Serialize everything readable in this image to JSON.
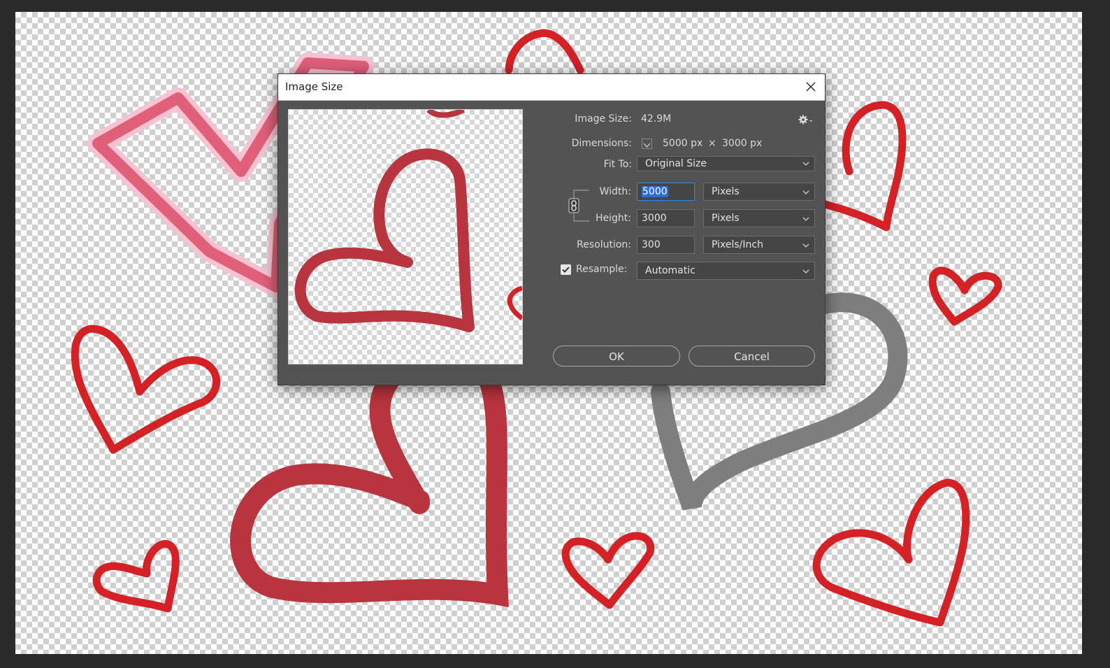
{
  "dialog": {
    "title": "Image Size",
    "image_size_label": "Image Size:",
    "image_size_value": "42.9M",
    "dimensions_label": "Dimensions:",
    "dimensions_width": "5000 px",
    "dimensions_separator": "×",
    "dimensions_height": "3000 px",
    "fit_to_label": "Fit To:",
    "fit_to_value": "Original Size",
    "width_label": "Width:",
    "width_value": "5000",
    "width_unit": "Pixels",
    "height_label": "Height:",
    "height_value": "3000",
    "height_unit": "Pixels",
    "resolution_label": "Resolution:",
    "resolution_value": "300",
    "resolution_unit": "Pixels/Inch",
    "resample_label": "Resample:",
    "resample_checked": true,
    "resample_value": "Automatic",
    "ok_label": "OK",
    "cancel_label": "Cancel"
  },
  "icons": {
    "close": "close-icon",
    "gear": "gear-icon",
    "link": "chain-link-icon",
    "dropdown": "chevron-down-icon",
    "checkbox": "checkmark-icon"
  },
  "colors": {
    "heart_red": "#d42126",
    "heart_rose": "#b8343e",
    "heart_pink": "#e0607a",
    "heart_gray": "#7e7e7e",
    "dialog_bg": "#535353",
    "focus_blue": "#2d8ceb"
  }
}
